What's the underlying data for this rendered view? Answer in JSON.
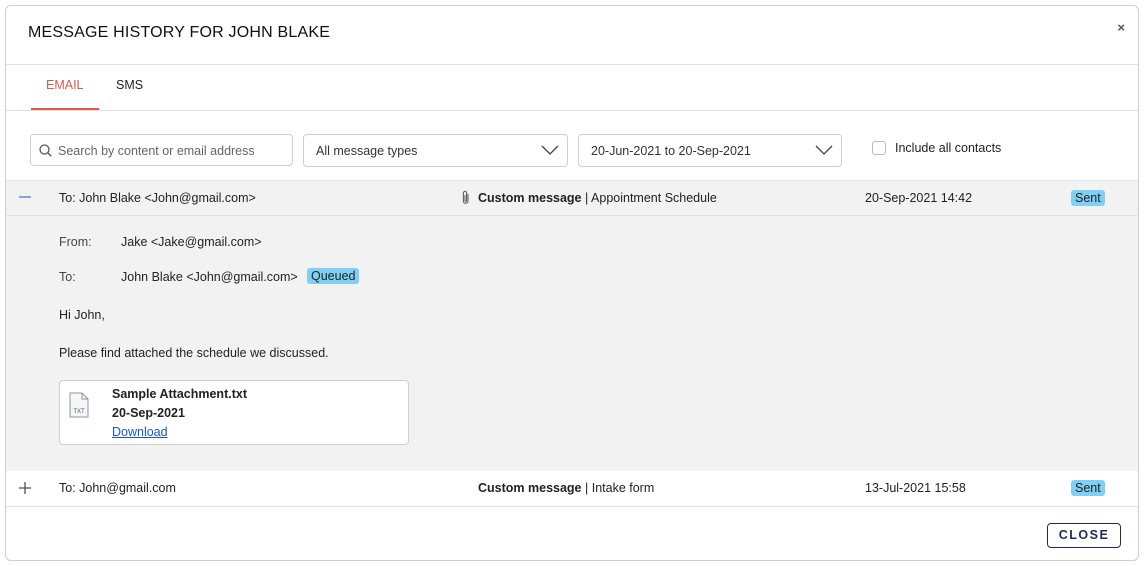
{
  "dialog": {
    "title": "MESSAGE HISTORY FOR JOHN BLAKE",
    "close_x": "×",
    "close_button": "CLOSE"
  },
  "tabs": [
    {
      "label": "EMAIL",
      "active": true
    },
    {
      "label": "SMS",
      "active": false
    }
  ],
  "filters": {
    "search_placeholder": "Search by content or email address",
    "message_type": "All message types",
    "date_range": "20-Jun-2021 to 20-Sep-2021",
    "include_all_contacts_label": "Include all contacts",
    "include_all_contacts_checked": false
  },
  "messages": [
    {
      "expanded": true,
      "toggle_icon": "minus-icon",
      "to": "To: John Blake <John@gmail.com>",
      "has_attachment": true,
      "type": "Custom message",
      "subject": "| Appointment Schedule",
      "date": "20-Sep-2021 14:42",
      "status": "Sent",
      "detail": {
        "from_label": "From:",
        "from_value": "Jake <Jake@gmail.com>",
        "to_label": "To:",
        "to_value": "John Blake <John@gmail.com>",
        "to_status": "Queued",
        "greeting": "Hi John,",
        "body": "Please find attached the schedule we discussed.",
        "attachment": {
          "icon_text": "TXT",
          "name": "Sample Attachment.txt",
          "date": "20-Sep-2021",
          "download_label": "Download"
        }
      }
    },
    {
      "expanded": false,
      "toggle_icon": "plus-icon",
      "to": "To: John@gmail.com",
      "has_attachment": false,
      "type": "Custom message",
      "subject": "| Intake form",
      "date": "13-Jul-2021 15:58",
      "status": "Sent"
    }
  ],
  "colors": {
    "accent": "#e0584a",
    "badge": "#7fd0f5",
    "link": "#1a55c9",
    "close_button": "#1f2a5c"
  }
}
